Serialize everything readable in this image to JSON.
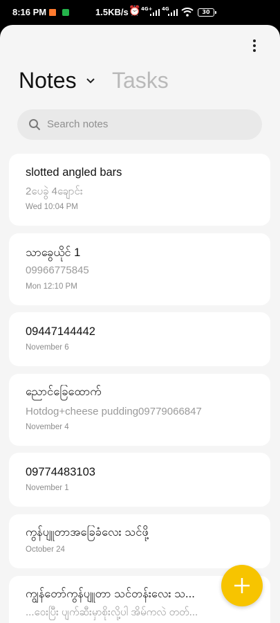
{
  "status_bar": {
    "time": "8:16 PM",
    "network_speed": "1.5KB/s",
    "net1_label": "4G+",
    "net2_label": "4G",
    "battery": "30"
  },
  "header": {
    "tab_notes": "Notes",
    "tab_tasks": "Tasks",
    "more_icon": "more-vert-icon"
  },
  "search": {
    "placeholder": "Search notes"
  },
  "notes": [
    {
      "title": "slotted angled bars",
      "snippet": "2ပေခွဲ 4ချောင်း",
      "date": "Wed 10:04 PM"
    },
    {
      "title": "သာခွေယိုင် 1",
      "snippet": "09966775845",
      "date": "Mon 12:10 PM"
    },
    {
      "title": "09447144442",
      "snippet": "",
      "date": "November 6"
    },
    {
      "title": "ညောင်ခြေထောက်",
      "snippet": "Hotdog+cheese pudding09779066847",
      "date": "November 4"
    },
    {
      "title": "09774483103",
      "snippet": "",
      "date": "November 1"
    },
    {
      "title": "ကွန်ပျူတာအခြေခံလေး သင်ဖို့",
      "snippet": "",
      "date": "October 24"
    },
    {
      "title": "ကျွန်တော်ကွန်ပျူတာ သင်တန်းလေး သ...",
      "snippet": "...ဝေးပြီး ပျက်ဆီးမှာစိုးလို့ပါ အိမ်ကလဲ တတ်...",
      "date": ""
    }
  ],
  "fab": {
    "icon": "plus-icon",
    "color": "#f7c400"
  }
}
